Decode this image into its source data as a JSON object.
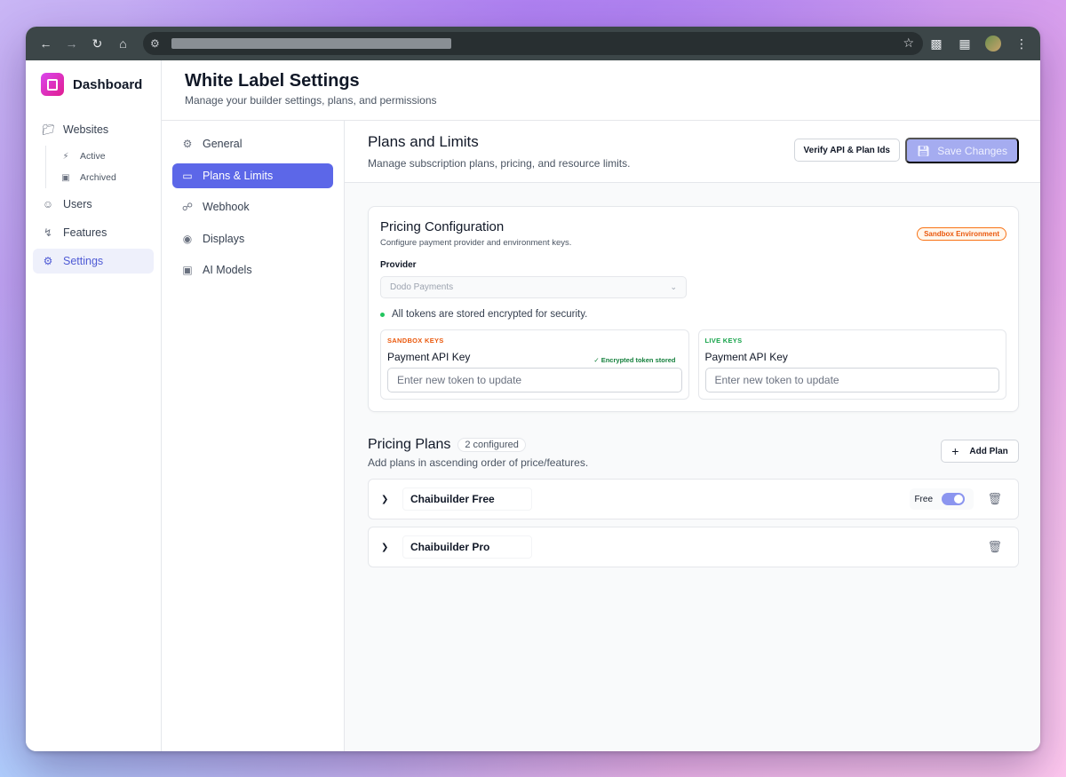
{
  "sidebar": {
    "brand": "Dashboard",
    "items": [
      {
        "label": "Websites",
        "icon": "folder-icon"
      },
      {
        "label": "Active",
        "icon": "bolt-icon"
      },
      {
        "label": "Archived",
        "icon": "archive-icon"
      },
      {
        "label": "Users",
        "icon": "users-icon"
      },
      {
        "label": "Features",
        "icon": "zap-icon"
      },
      {
        "label": "Settings",
        "icon": "gear-icon"
      }
    ]
  },
  "header": {
    "title": "White Label Settings",
    "subtitle": "Manage your builder settings, plans, and permissions"
  },
  "settings_nav": [
    {
      "label": "General",
      "icon": "gear-icon"
    },
    {
      "label": "Plans & Limits",
      "icon": "card-icon"
    },
    {
      "label": "Webhook",
      "icon": "webhook-icon"
    },
    {
      "label": "Displays",
      "icon": "eye-icon"
    },
    {
      "label": "AI Models",
      "icon": "bot-icon"
    }
  ],
  "panel": {
    "title": "Plans and Limits",
    "subtitle": "Manage subscription plans, pricing, and resource limits.",
    "verify_label": "Verify API & Plan Ids",
    "save_label": "Save Changes"
  },
  "pricing_config": {
    "title": "Pricing Configuration",
    "subtitle": "Configure payment provider and environment keys.",
    "badge": "Sandbox Environment",
    "provider_label": "Provider",
    "provider_value": "Dodo Payments",
    "note": "All tokens are stored encrypted for security.",
    "sandbox": {
      "section": "SANDBOX KEYS",
      "field_label": "Payment API Key",
      "stored": "Encrypted token stored",
      "placeholder": "Enter new token to update"
    },
    "live": {
      "section": "LIVE KEYS",
      "field_label": "Payment API Key",
      "placeholder": "Enter new token to update"
    }
  },
  "pricing_plans": {
    "title": "Pricing Plans",
    "count": "2 configured",
    "subtitle": "Add plans in ascending order of price/features.",
    "add_label": "Add Plan",
    "plans": [
      {
        "name": "Chaibuilder Free",
        "free_label": "Free",
        "free_enabled": true
      },
      {
        "name": "Chaibuilder Pro"
      }
    ]
  },
  "colors": {
    "accent": "#5c67e8",
    "brand": "#d946ef",
    "sandbox": "#ea580c",
    "live": "#16a34a"
  }
}
